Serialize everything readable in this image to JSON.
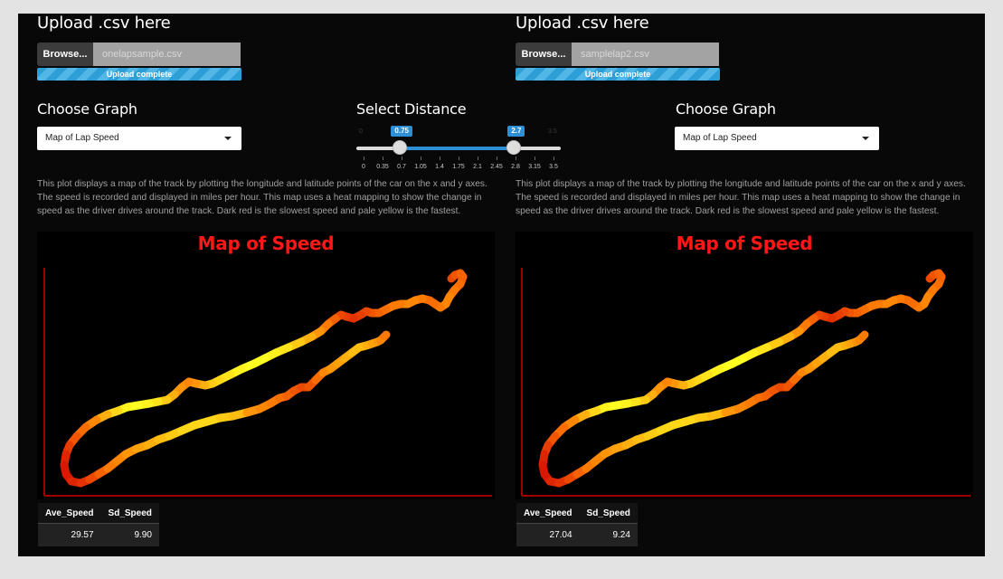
{
  "left": {
    "upload_heading": "Upload .csv here",
    "browse_label": "Browse...",
    "file_name": "onelapsample.csv",
    "upload_status": "Upload complete",
    "graph_heading": "Choose Graph",
    "graph_selected": "Map of Lap Speed",
    "description": "This plot displays a map of the track by plotting the longitude and latitude points of the car on the x and y axes. The speed is recorded and displayed in miles per hour. This map uses a heat mapping to show the change in speed as the driver drives around the track. Dark red is the slowest speed and pale yellow is the fastest.",
    "plot_title": "Map of Speed",
    "stats": {
      "headers": [
        "Ave_Speed",
        "Sd_Speed"
      ],
      "values": [
        "29.57",
        "9.90"
      ]
    }
  },
  "right": {
    "upload_heading": "Upload .csv here",
    "browse_label": "Browse...",
    "file_name": "samplelap2.csv",
    "upload_status": "Upload complete",
    "graph_heading": "Choose Graph",
    "graph_selected": "Map of Lap Speed",
    "description": "This plot displays a map of the track by plotting the longitude and latitude points of the car on the x and y axes. The speed is recorded and displayed in miles per hour. This map uses a heat mapping to show the change in speed as the driver drives around the track. Dark red is the slowest speed and pale yellow is the fastest.",
    "plot_title": "Map of Speed",
    "stats": {
      "headers": [
        "Ave_Speed",
        "Sd_Speed"
      ],
      "values": [
        "27.04",
        "9.24"
      ]
    }
  },
  "distance": {
    "heading": "Select Distance",
    "min_label": "0",
    "max_label": "3.5",
    "from": "0.75",
    "to": "2.7",
    "range_min": 0,
    "range_max": 3.5,
    "ticks": [
      "0",
      "0.35",
      "0.7",
      "1.05",
      "1.4",
      "1.75",
      "2.1",
      "2.45",
      "2.8",
      "3.15",
      "3.5"
    ]
  },
  "colors": {
    "slow": "#d00000",
    "mid": "#ff7a00",
    "fast": "#ffff22",
    "title": "#ff1616",
    "accent": "#2d8fd5"
  },
  "chart_data": [
    {
      "type": "scatter",
      "title": "Map of Speed",
      "xlabel": "",
      "ylabel": "",
      "encoding": "color = speed (dark red slow, pale yellow fast)"
    },
    {
      "type": "scatter",
      "title": "Map of Speed",
      "xlabel": "",
      "ylabel": "",
      "encoding": "color = speed (dark red slow, pale yellow fast)"
    }
  ]
}
